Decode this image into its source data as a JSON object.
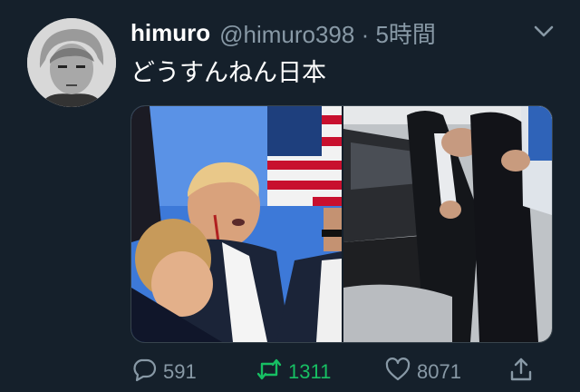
{
  "tweet": {
    "display_name": "himuro",
    "handle_time": "@himuro398 · 5時間",
    "text": "どうすんねん日本"
  },
  "icons": {
    "menu": "chevron-down-icon",
    "reply": "comment-icon",
    "retweet": "retweet-icon",
    "like": "heart-icon",
    "share": "share-icon"
  },
  "actions": {
    "reply_count": "591",
    "retweet_count": "1311",
    "like_count": "8071"
  },
  "colors": {
    "background": "#15202b",
    "secondary_text": "#8899a6",
    "retweet_active": "#17bf63"
  }
}
